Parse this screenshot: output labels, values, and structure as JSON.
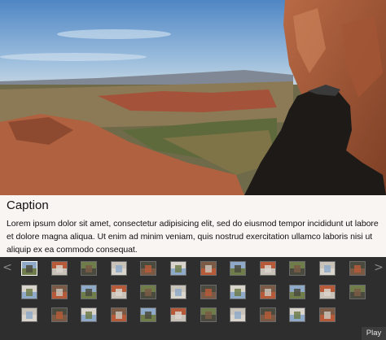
{
  "slideshow": {
    "caption": {
      "title": "Caption",
      "text": "Lorem ipsum dolor sit amet, consectetur adipisicing elit, sed do eiusmod tempor incididunt ut labore et dolore magna aliqua. Ut enim ad minim veniam, quis nostrud exercitation ullamco laboris nisi ut aliquip ex ea commodo consequat."
    },
    "nav": {
      "prev_glyph": "<",
      "next_glyph": ">"
    },
    "play_label": "Play",
    "thumbnails": {
      "total": 35,
      "active_index": 0,
      "rows": [
        12,
        12,
        11
      ],
      "palette": [
        "#8fa9c8",
        "#b65a3a",
        "#6e7d4a",
        "#c8c2b8",
        "#4a4a3e",
        "#d9d4cc",
        "#7a5a45"
      ]
    }
  }
}
